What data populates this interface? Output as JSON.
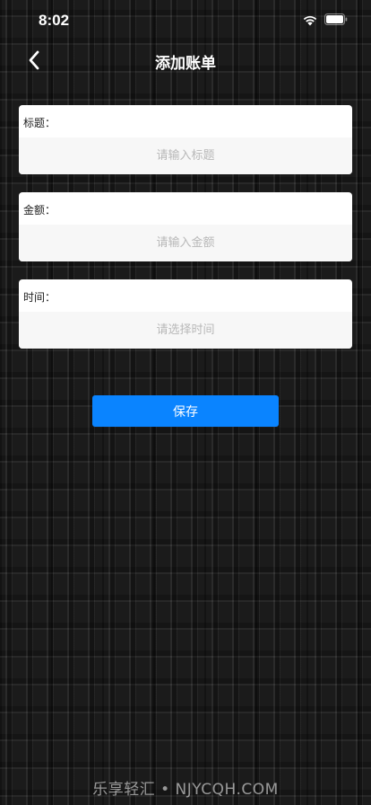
{
  "status_bar": {
    "time": "8:02"
  },
  "nav": {
    "title": "添加账单"
  },
  "form": {
    "title": {
      "label": "标题：",
      "placeholder": "请输入标题"
    },
    "amount": {
      "label": "金额：",
      "placeholder": "请输入金额"
    },
    "time": {
      "label": "时间：",
      "placeholder": "请选择时间"
    }
  },
  "save_button": {
    "label": "保存"
  },
  "watermark": {
    "text": "乐享轻汇 • NJYCQH.COM"
  },
  "colors": {
    "accent": "#0a84ff",
    "card": "#ffffff",
    "input_bg": "#f7f7f7"
  }
}
